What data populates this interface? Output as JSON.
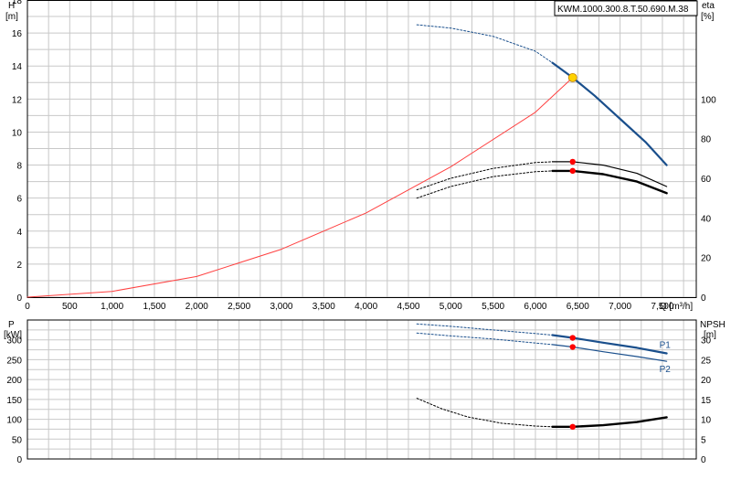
{
  "title_box": "KWM.1000.300.8.T.50.690.M.38",
  "chart_data": [
    {
      "type": "line",
      "name": "head-efficiency",
      "left_axis": {
        "label_top": "H",
        "label_unit": "[m]",
        "ticks": [
          0,
          2,
          4,
          6,
          8,
          10,
          12,
          14,
          16,
          18
        ],
        "ylim": [
          0,
          18
        ]
      },
      "right_axis": {
        "label_top": "eta",
        "label_unit": "[%]",
        "ticks": [
          0,
          20,
          40,
          60,
          80,
          100
        ],
        "ylim": [
          0,
          150
        ]
      },
      "x_axis": {
        "label": "Q [m³/h]",
        "ticks": [
          0,
          500,
          1000,
          1500,
          2000,
          2500,
          3000,
          3500,
          4000,
          4500,
          5000,
          5500,
          6000,
          6500,
          7000,
          7500
        ],
        "tick_labels": [
          "0",
          "500",
          "1,000",
          "1,500",
          "2,000",
          "2,500",
          "3,000",
          "3,500",
          "4,000",
          "4,500",
          "5,000",
          "5,500",
          "6,000",
          "6,500",
          "7,000",
          "7,500"
        ],
        "xlim": [
          0,
          7900
        ]
      },
      "system_curve": {
        "color": "#ff4040",
        "x": [
          0,
          1000,
          2000,
          3000,
          4000,
          5000,
          6000,
          6440
        ],
        "y": [
          0,
          0.35,
          1.25,
          2.9,
          5.1,
          7.9,
          11.2,
          13.3
        ]
      },
      "head_curve_dashed": {
        "x": [
          4600,
          5000,
          5500,
          6000,
          6200
        ],
        "y": [
          16.5,
          16.3,
          15.8,
          14.9,
          14.2
        ]
      },
      "head_curve_solid": {
        "color": "#1a4f8c",
        "x": [
          6200,
          6440,
          6700,
          7000,
          7300,
          7550
        ],
        "y": [
          14.2,
          13.3,
          12.2,
          10.8,
          9.4,
          8.0
        ]
      },
      "operating_point": {
        "x": 6440,
        "y": 13.3,
        "color": "#ffd200"
      },
      "eta_curve_1_dashed": {
        "x": [
          4600,
          5000,
          5500,
          6000,
          6200
        ],
        "y": [
          6.5,
          7.2,
          7.8,
          8.15,
          8.2
        ]
      },
      "eta_curve_1_solid": {
        "x": [
          6200,
          6440,
          6800,
          7200,
          7550
        ],
        "y": [
          8.2,
          8.2,
          8.0,
          7.5,
          6.7
        ]
      },
      "eta_curve_2_dashed": {
        "x": [
          4600,
          5000,
          5500,
          6000,
          6200
        ],
        "y": [
          6.0,
          6.7,
          7.3,
          7.6,
          7.65
        ]
      },
      "eta_curve_2_solid": {
        "x": [
          6200,
          6440,
          6800,
          7200,
          7550
        ],
        "y": [
          7.65,
          7.65,
          7.45,
          7.0,
          6.3
        ]
      },
      "eta_points": [
        {
          "x": 6440,
          "y": 8.2
        },
        {
          "x": 6440,
          "y": 7.65
        }
      ]
    },
    {
      "type": "line",
      "name": "power-npsh",
      "left_axis": {
        "label_top": "P",
        "label_unit": "[kW]",
        "ticks": [
          0,
          50,
          100,
          150,
          200,
          250,
          300
        ],
        "ylim": [
          0,
          350
        ]
      },
      "right_axis": {
        "label_top": "NPSH",
        "label_unit": "[m]",
        "ticks": [
          0,
          5,
          10,
          15,
          20,
          25,
          30
        ],
        "ylim": [
          0,
          35
        ]
      },
      "p1_dashed": {
        "x": [
          4600,
          5000,
          5500,
          6000,
          6200
        ],
        "y": [
          340,
          334,
          325,
          316,
          312
        ]
      },
      "p1_solid": {
        "label": "P1",
        "color": "#1a4f8c",
        "x": [
          6200,
          6440,
          6800,
          7200,
          7550
        ],
        "y": [
          312,
          305,
          293,
          280,
          266
        ]
      },
      "p2_dashed": {
        "x": [
          4600,
          5000,
          5500,
          6000,
          6200
        ],
        "y": [
          317,
          310,
          302,
          292,
          288
        ]
      },
      "p2_solid": {
        "label": "P2",
        "color": "#1a4f8c",
        "x": [
          6200,
          6440,
          6800,
          7200,
          7550
        ],
        "y": [
          288,
          282,
          270,
          258,
          246
        ]
      },
      "npsh_dashed": {
        "x": [
          4600,
          4900,
          5200,
          5600,
          6000,
          6200
        ],
        "y": [
          15.3,
          12.6,
          10.6,
          9.0,
          8.3,
          8.1
        ]
      },
      "npsh_solid": {
        "x": [
          6200,
          6440,
          6800,
          7200,
          7550
        ],
        "y": [
          8.1,
          8.1,
          8.5,
          9.3,
          10.5
        ]
      },
      "points": [
        {
          "x": 6440,
          "y": 305
        },
        {
          "x": 6440,
          "y": 282
        }
      ],
      "npsh_point": {
        "x": 6440,
        "y": 8.1
      }
    }
  ]
}
